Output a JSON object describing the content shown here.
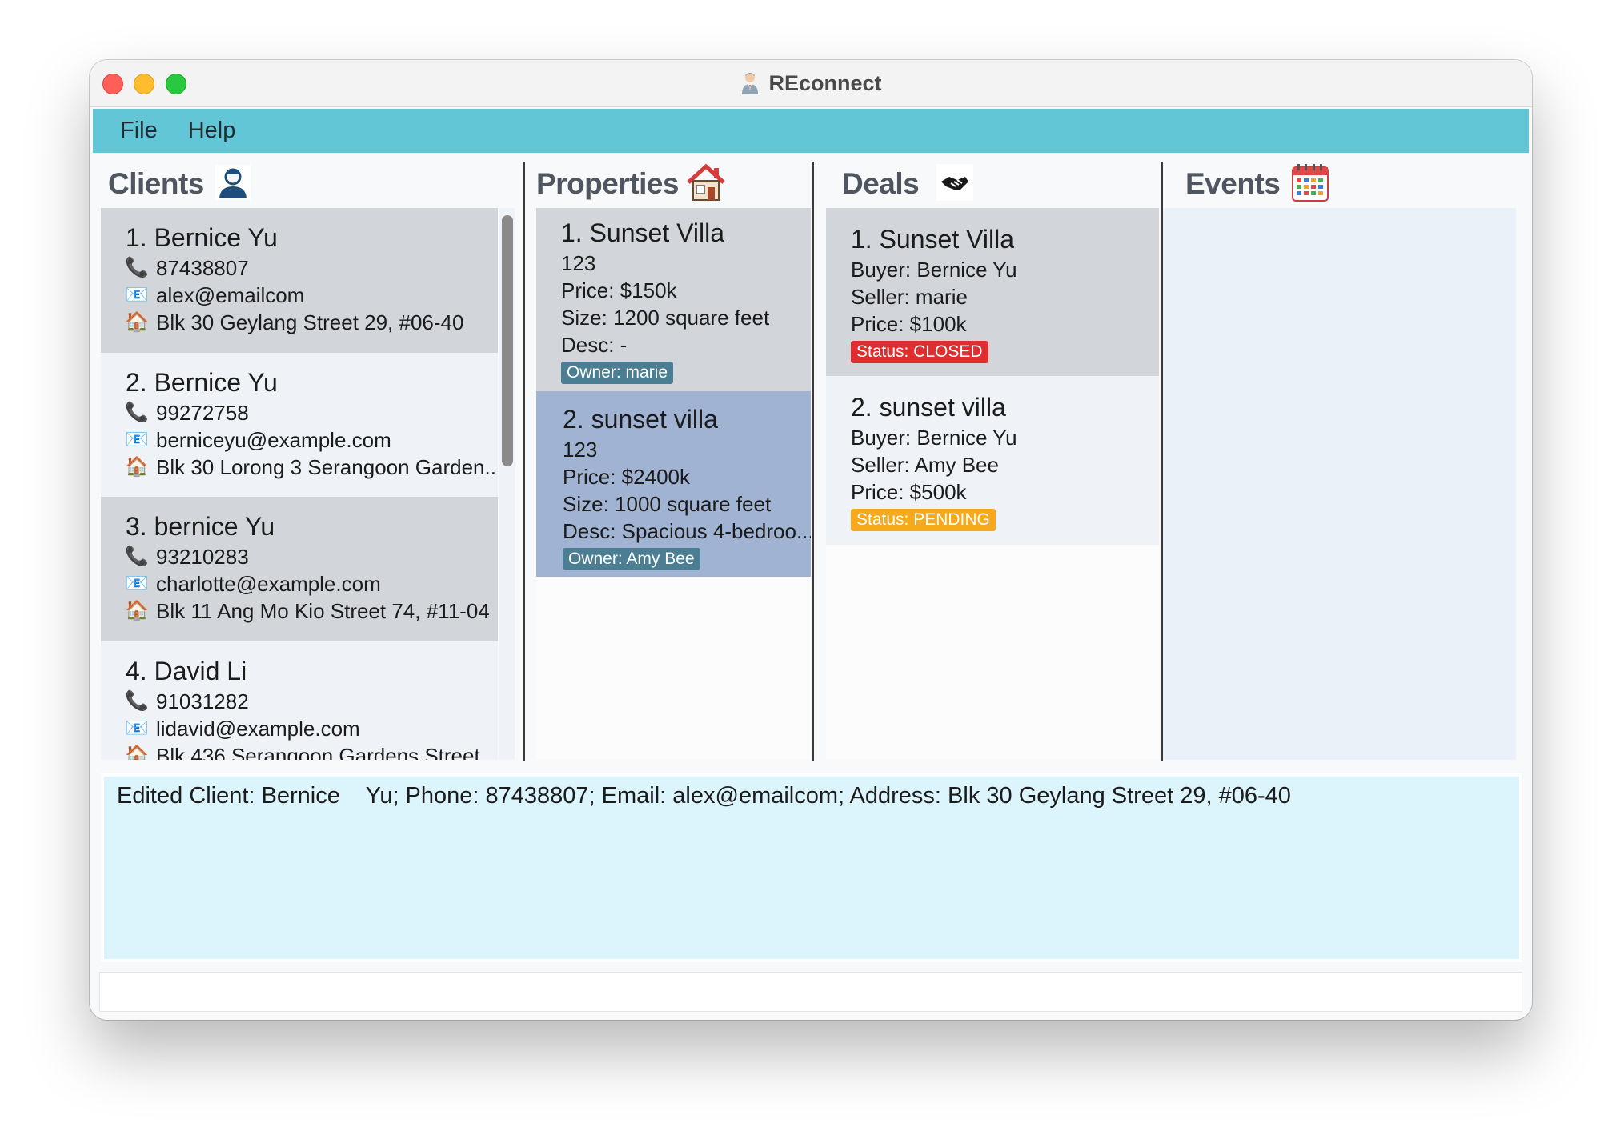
{
  "window": {
    "title": "REconnect",
    "app_icon": "agent-person-icon"
  },
  "menubar": {
    "items": [
      "File",
      "Help"
    ]
  },
  "panels": {
    "clients": {
      "title": "Clients",
      "icon": "person-icon"
    },
    "properties": {
      "title": "Properties",
      "icon": "house-icon"
    },
    "deals": {
      "title": "Deals",
      "icon": "handshake-icon"
    },
    "events": {
      "title": "Events",
      "icon": "calendar-icon"
    }
  },
  "clients": [
    {
      "name": "1. Bernice    Yu",
      "phone": "87438807",
      "email": "alex@emailcom",
      "address": "Blk 30 Geylang Street 29, #06-40"
    },
    {
      "name": "2. Bernice Yu",
      "phone": "99272758",
      "email": "berniceyu@example.com",
      "address": "Blk 30 Lorong 3 Serangoon Garden..."
    },
    {
      "name": "3. bernice Yu",
      "phone": "93210283",
      "email": "charlotte@example.com",
      "address": "Blk 11 Ang Mo Kio Street 74, #11-04"
    },
    {
      "name": "4. David Li",
      "phone": "91031282",
      "email": "lidavid@example.com",
      "address": "Blk 436 Serangoon Gardens Street"
    }
  ],
  "properties": [
    {
      "name": "1. Sunset Villa",
      "unit": "123",
      "price": "Price: $150k",
      "size": "Size: 1200 square feet",
      "desc": "Desc: -",
      "owner": "Owner: marie"
    },
    {
      "name": "2. sunset villa",
      "unit": "123",
      "price": "Price: $2400k",
      "size": "Size: 1000 square feet",
      "desc": "Desc: Spacious 4-bedroo...",
      "owner": "Owner: Amy Bee"
    }
  ],
  "deals": [
    {
      "name": "1. Sunset Villa",
      "buyer": "Buyer: Bernice    Yu",
      "seller": "Seller: marie",
      "price": "Price: $100k",
      "status": "Status: CLOSED",
      "status_color": "#e02d2f"
    },
    {
      "name": "2. sunset villa",
      "buyer": "Buyer: Bernice Yu",
      "seller": "Seller: Amy Bee",
      "price": "Price: $500k",
      "status": "Status: PENDING",
      "status_color": "#f6a91c"
    }
  ],
  "result": {
    "text": "Edited Client: Bernice    Yu; Phone: 87438807; Email: alex@emailcom; Address: Blk 30 Geylang Street 29, #06-40"
  },
  "command": {
    "value": ""
  },
  "colors": {
    "menubar": "#62c6d7",
    "selected_card": "#a0b3d3",
    "result_bg": "#dcf4fb"
  }
}
